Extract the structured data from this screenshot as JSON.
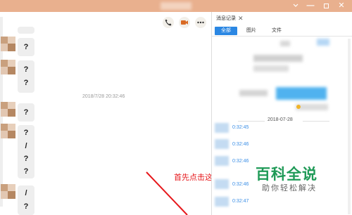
{
  "window": {
    "controls": {
      "more_icon": "chevron-down-icon",
      "min_label": "—",
      "close_label": "✕"
    }
  },
  "chat": {
    "toolbar": [
      {
        "name": "phone-icon"
      },
      {
        "name": "video-icon"
      },
      {
        "name": "more-icon",
        "label": "•••"
      }
    ],
    "messages_before": [
      {
        "lines": [
          "?"
        ]
      },
      {
        "lines": [
          "?",
          "?"
        ]
      }
    ],
    "timestamp": "2018/7/28 20:32:46",
    "messages_after": [
      {
        "lines": [
          "?"
        ]
      },
      {
        "lines": [
          "?",
          "/",
          "?",
          "?"
        ]
      },
      {
        "lines": [
          "/",
          "?"
        ]
      }
    ]
  },
  "annotation": "首先点击这图标",
  "history": {
    "title": "消息记录",
    "close_label": "✕",
    "filters": [
      "全部",
      "图片",
      "文件"
    ],
    "date_separator": "2018-07-28",
    "entries": [
      "0:32:45",
      "0:32:46",
      "0:32:46",
      "0:32:46",
      "0:32:47"
    ]
  },
  "watermark": {
    "logo": "百科全说",
    "subtitle": "助你轻松解决"
  },
  "colors": {
    "titlebar": "#e9b08e",
    "accent": "#2b87e3",
    "annotation": "#e6171b",
    "watermark": "#1f9a57"
  }
}
